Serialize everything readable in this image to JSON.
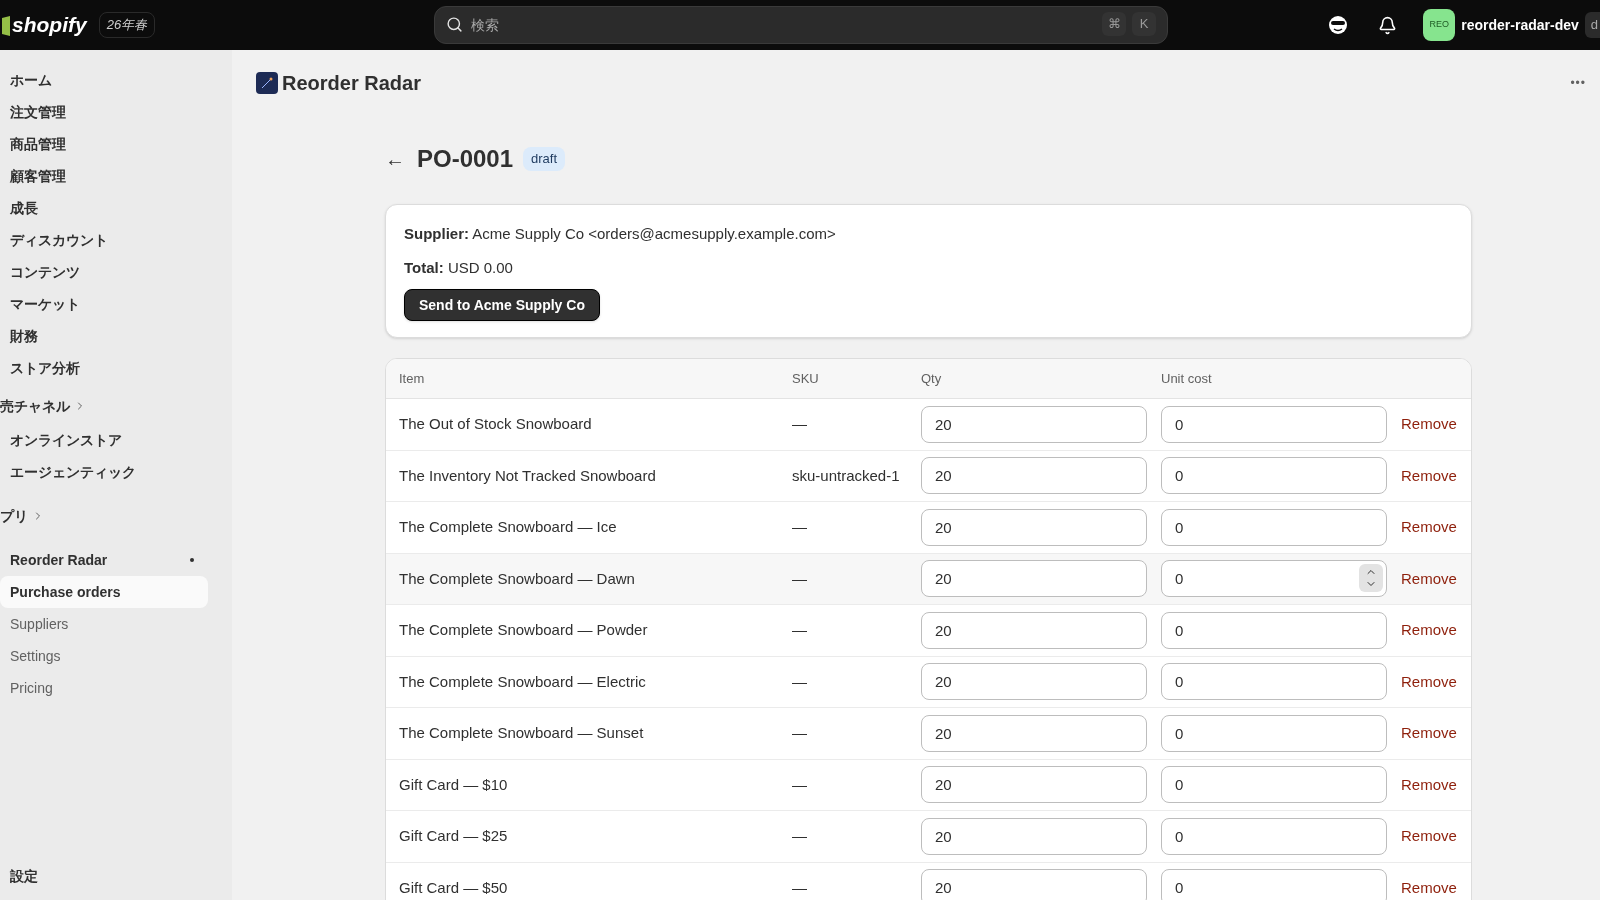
{
  "top_bar": {
    "logo": "shopify",
    "edition": "26年春",
    "search": {
      "placeholder": "検索",
      "shortcut": [
        "⌘",
        "K"
      ]
    },
    "avatar": "REO",
    "store": "reorder-radar-dev",
    "cut_badge": "d"
  },
  "sidebar": {
    "items": [
      {
        "label": "ホーム",
        "selected": false
      },
      {
        "label": "注文管理",
        "selected": false
      },
      {
        "label": "商品管理",
        "selected": false
      },
      {
        "label": "顧客管理",
        "selected": false
      },
      {
        "label": "成長",
        "selected": false
      },
      {
        "label": "ディスカウント",
        "selected": false
      },
      {
        "label": "コンテンツ",
        "selected": false
      },
      {
        "label": "マーケット",
        "selected": false
      },
      {
        "label": "財務",
        "selected": false
      },
      {
        "label": "ストア分析",
        "selected": false
      }
    ],
    "channels": {
      "title": "売チャネル",
      "items": [
        {
          "label": "オンラインストア",
          "selected": false
        },
        {
          "label": "エージェンティック",
          "selected": false
        }
      ]
    },
    "apps": {
      "title": "プリ",
      "app": "Reorder Radar",
      "items": [
        {
          "label": "Purchase orders",
          "selected": true
        },
        {
          "label": "Suppliers",
          "selected": false
        },
        {
          "label": "Settings",
          "selected": false
        },
        {
          "label": "Pricing",
          "selected": false
        }
      ]
    },
    "settings": "設定"
  },
  "app_header": {
    "title": "Reorder Radar",
    "menu": "•••"
  },
  "page": {
    "back": "←",
    "title": "PO-0001",
    "status": "draft",
    "summary": {
      "supplier_label": "Supplier:",
      "supplier": "Acme Supply Co <orders@acmesupply.example.com>",
      "total_label": "Total:",
      "total": "USD 0.00",
      "send_button": "Send to Acme Supply Co"
    },
    "table": {
      "columns": [
        "Item",
        "SKU",
        "Qty",
        "Unit cost"
      ],
      "rows": [
        {
          "item": "The Out of Stock Snowboard",
          "sku": "—",
          "qty": "20",
          "unit_cost": "0",
          "remove": "Remove",
          "hovered": false
        },
        {
          "item": "The Inventory Not Tracked Snowboard",
          "sku": "sku-untracked-1",
          "qty": "20",
          "unit_cost": "0",
          "remove": "Remove",
          "hovered": false
        },
        {
          "item": "The Complete Snowboard — Ice",
          "sku": "—",
          "qty": "20",
          "unit_cost": "0",
          "remove": "Remove",
          "hovered": false
        },
        {
          "item": "The Complete Snowboard — Dawn",
          "sku": "—",
          "qty": "20",
          "unit_cost": "0",
          "remove": "Remove",
          "hovered": true
        },
        {
          "item": "The Complete Snowboard — Powder",
          "sku": "—",
          "qty": "20",
          "unit_cost": "0",
          "remove": "Remove",
          "hovered": false
        },
        {
          "item": "The Complete Snowboard — Electric",
          "sku": "—",
          "qty": "20",
          "unit_cost": "0",
          "remove": "Remove",
          "hovered": false
        },
        {
          "item": "The Complete Snowboard — Sunset",
          "sku": "—",
          "qty": "20",
          "unit_cost": "0",
          "remove": "Remove",
          "hovered": false
        },
        {
          "item": "Gift Card — $10",
          "sku": "—",
          "qty": "20",
          "unit_cost": "0",
          "remove": "Remove",
          "hovered": false
        },
        {
          "item": "Gift Card — $25",
          "sku": "—",
          "qty": "20",
          "unit_cost": "0",
          "remove": "Remove",
          "hovered": false
        },
        {
          "item": "Gift Card — $50",
          "sku": "—",
          "qty": "20",
          "unit_cost": "0",
          "remove": "Remove",
          "hovered": false
        }
      ]
    }
  }
}
